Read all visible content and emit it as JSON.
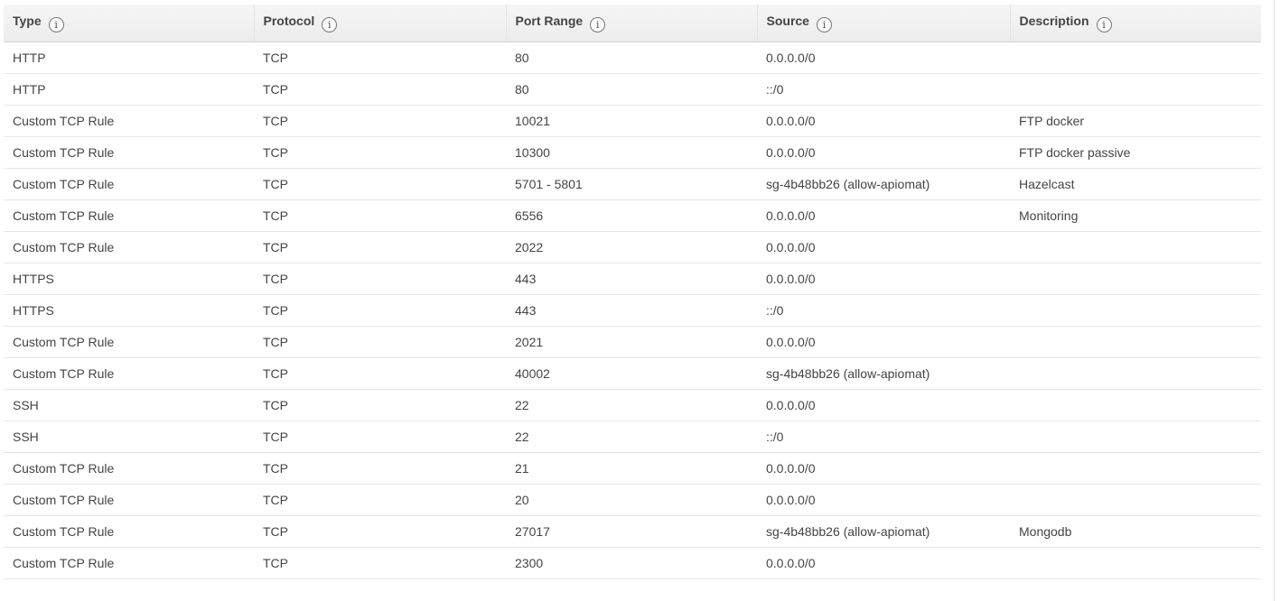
{
  "table": {
    "headers": [
      {
        "label": "Type",
        "icon": "info-icon"
      },
      {
        "label": "Protocol",
        "icon": "info-icon"
      },
      {
        "label": "Port Range",
        "icon": "info-icon"
      },
      {
        "label": "Source",
        "icon": "info-icon"
      },
      {
        "label": "Description",
        "icon": "info-icon"
      }
    ],
    "info_glyph": "i",
    "rows": [
      [
        "HTTP",
        "TCP",
        "80",
        "0.0.0.0/0",
        ""
      ],
      [
        "HTTP",
        "TCP",
        "80",
        "::/0",
        ""
      ],
      [
        "Custom TCP Rule",
        "TCP",
        "10021",
        "0.0.0.0/0",
        "FTP docker"
      ],
      [
        "Custom TCP Rule",
        "TCP",
        "10300",
        "0.0.0.0/0",
        "FTP docker passive"
      ],
      [
        "Custom TCP Rule",
        "TCP",
        "5701 - 5801",
        "sg-4b48bb26 (allow-apiomat)",
        "Hazelcast"
      ],
      [
        "Custom TCP Rule",
        "TCP",
        "6556",
        "0.0.0.0/0",
        "Monitoring"
      ],
      [
        "Custom TCP Rule",
        "TCP",
        "2022",
        "0.0.0.0/0",
        ""
      ],
      [
        "HTTPS",
        "TCP",
        "443",
        "0.0.0.0/0",
        ""
      ],
      [
        "HTTPS",
        "TCP",
        "443",
        "::/0",
        ""
      ],
      [
        "Custom TCP Rule",
        "TCP",
        "2021",
        "0.0.0.0/0",
        ""
      ],
      [
        "Custom TCP Rule",
        "TCP",
        "40002",
        "sg-4b48bb26 (allow-apiomat)",
        ""
      ],
      [
        "SSH",
        "TCP",
        "22",
        "0.0.0.0/0",
        ""
      ],
      [
        "SSH",
        "TCP",
        "22",
        "::/0",
        ""
      ],
      [
        "Custom TCP Rule",
        "TCP",
        "21",
        "0.0.0.0/0",
        ""
      ],
      [
        "Custom TCP Rule",
        "TCP",
        "20",
        "0.0.0.0/0",
        ""
      ],
      [
        "Custom TCP Rule",
        "TCP",
        "27017",
        "sg-4b48bb26 (allow-apiomat)",
        "Mongodb"
      ],
      [
        "Custom TCP Rule",
        "TCP",
        "2300",
        "0.0.0.0/0",
        ""
      ]
    ]
  }
}
